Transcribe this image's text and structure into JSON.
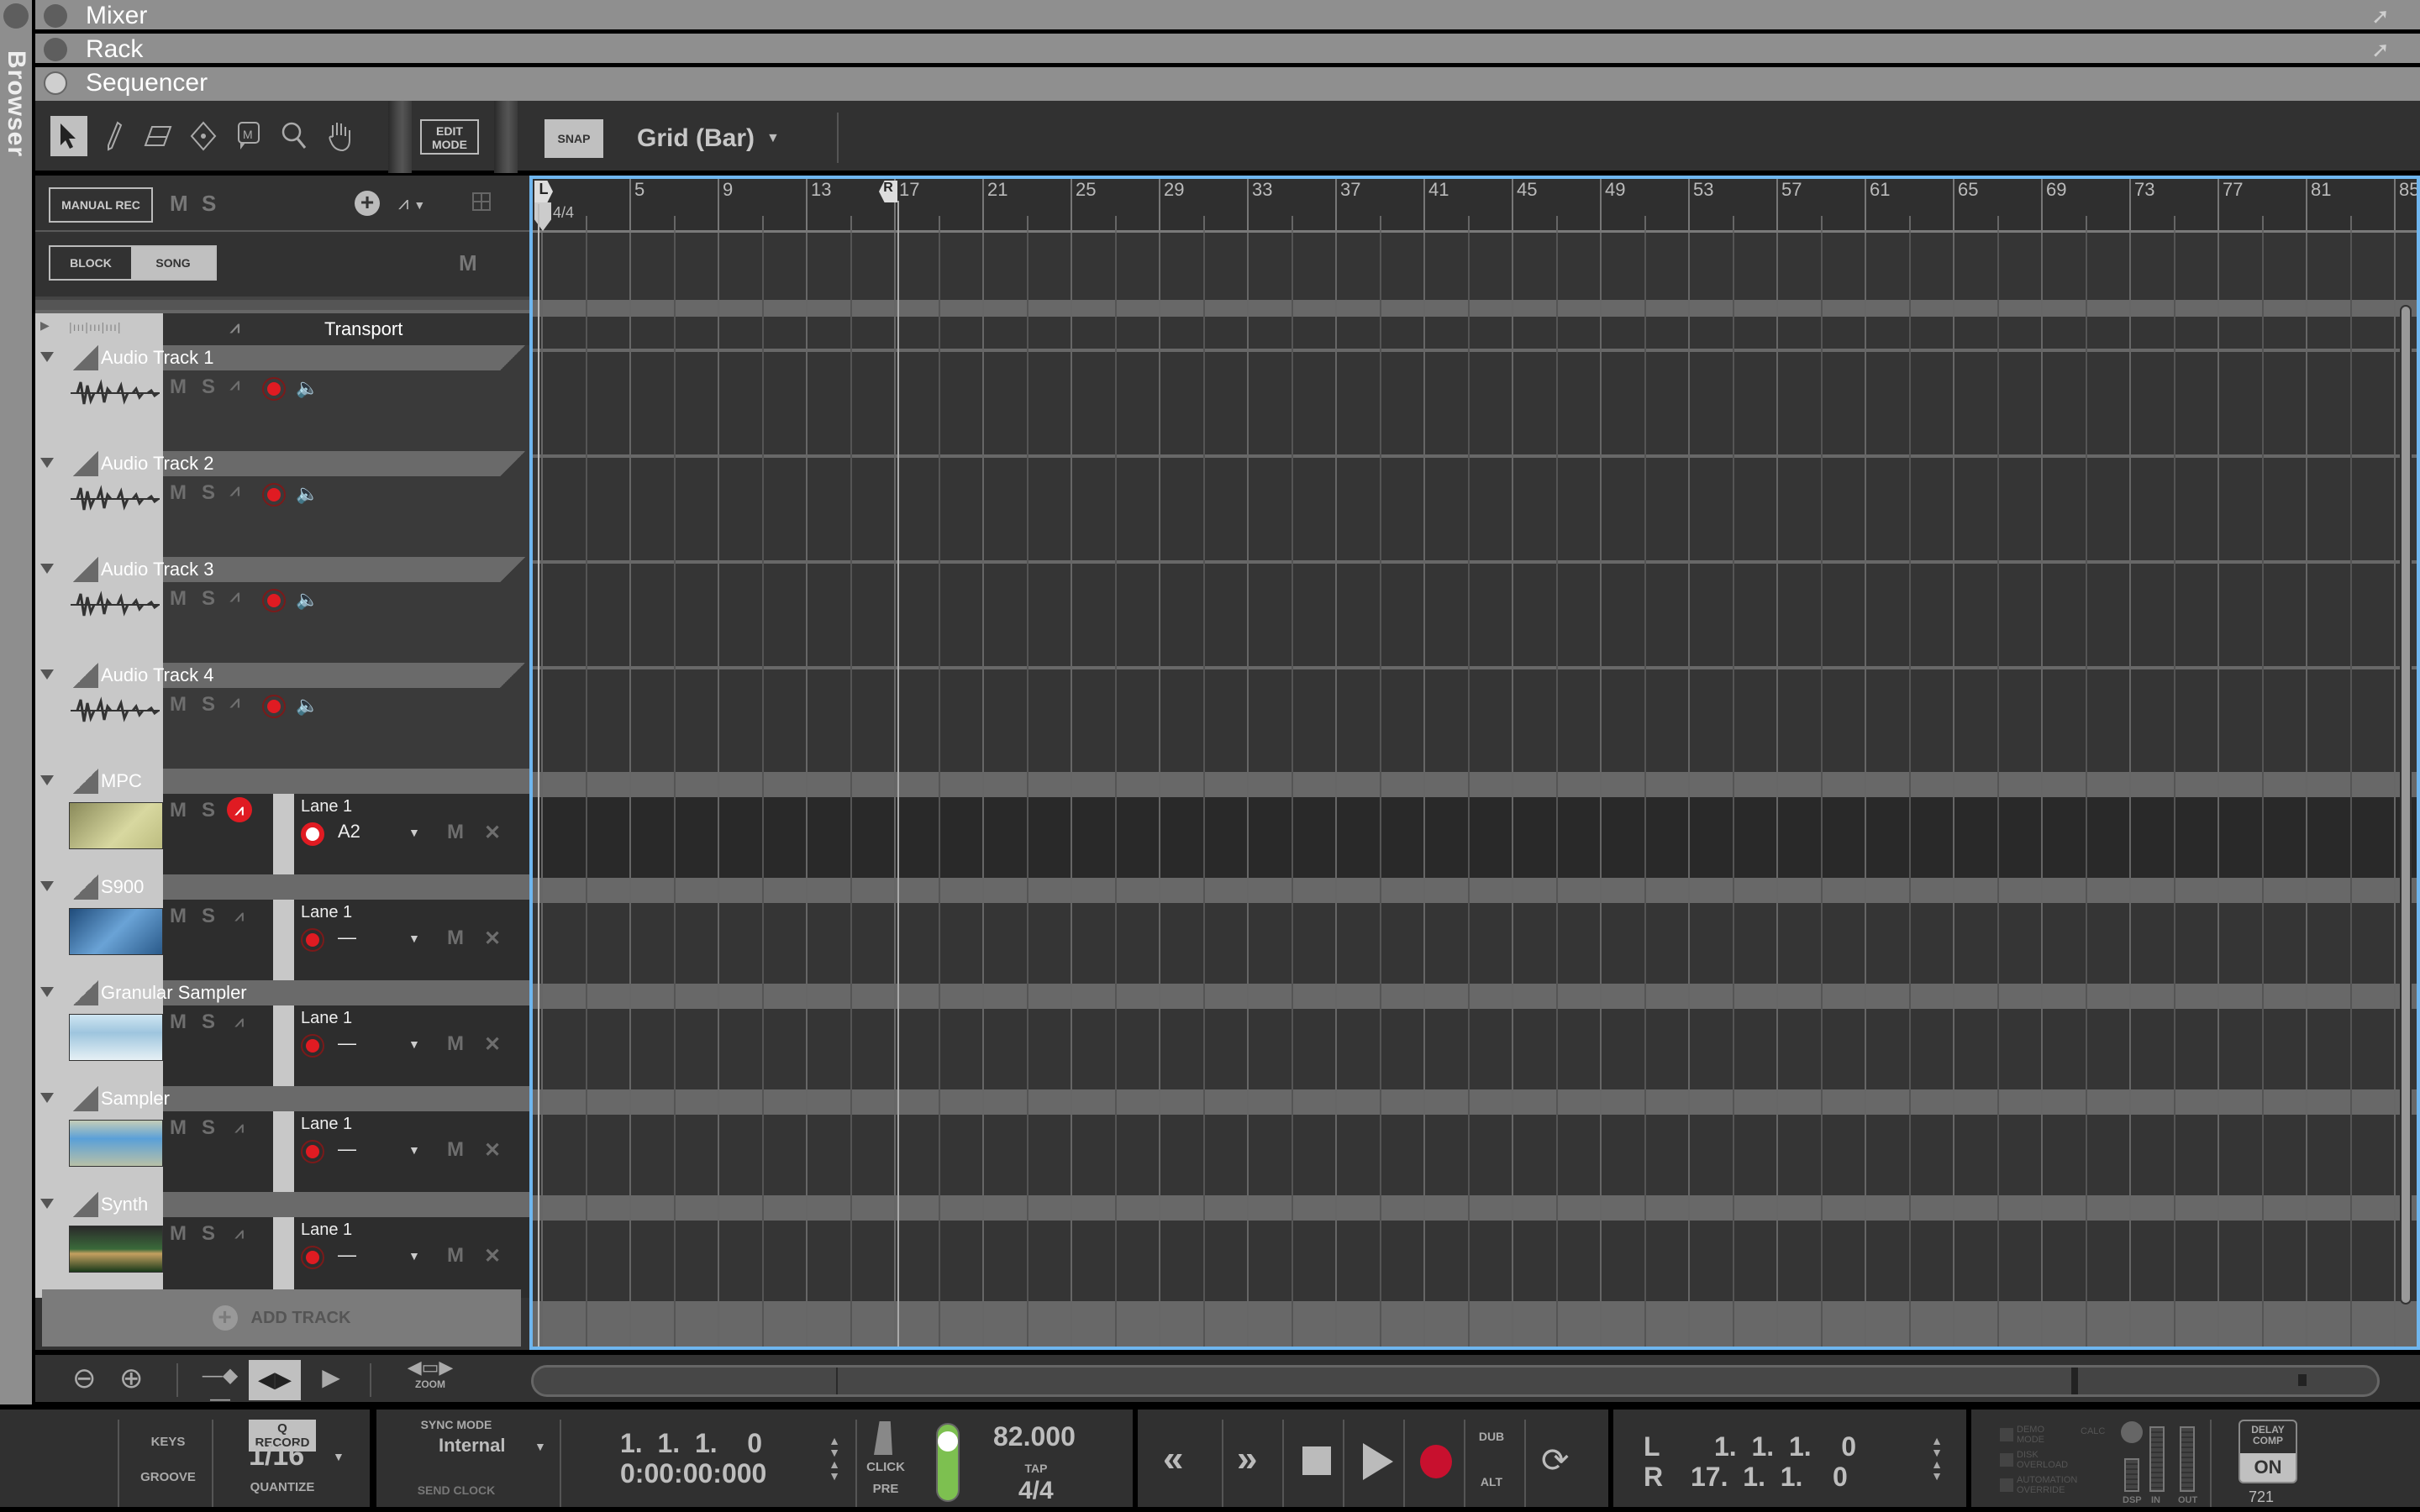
{
  "browser": {
    "label": "Browser"
  },
  "panels": [
    {
      "label": "Mixer",
      "active": false
    },
    {
      "label": "Rack",
      "active": false
    },
    {
      "label": "Sequencer",
      "active": true
    }
  ],
  "toolbar": {
    "tools": [
      "select-tool",
      "pencil-tool",
      "eraser-tool",
      "razor-tool",
      "mute-tool",
      "magnify-tool",
      "hand-tool"
    ],
    "edit_mode_label": "EDIT MODE",
    "snap_label": "SNAP",
    "grid_value": "Grid (Bar)"
  },
  "header": {
    "manual_rec_label": "MANUAL REC",
    "mute_label": "M",
    "solo_label": "S",
    "block_label": "BLOCK",
    "song_label": "SONG",
    "song_active": true,
    "master_mute_label": "M",
    "transport_track_label": "Transport"
  },
  "ruler": {
    "bars": [
      "5",
      "9",
      "13",
      "17",
      "21",
      "25",
      "29",
      "33",
      "37",
      "41",
      "45",
      "49",
      "53",
      "57",
      "61",
      "65",
      "69",
      "73",
      "77",
      "81",
      "85"
    ],
    "left_locator": "L",
    "right_locator": "R",
    "signature": "4/4",
    "left_locator_bar": 1,
    "right_locator_bar": 17,
    "song_position_bar": 1
  },
  "tracks": [
    {
      "name": "Audio Track 1",
      "type": "audio",
      "mute": "M",
      "solo": "S",
      "record_armed": false
    },
    {
      "name": "Audio Track 2",
      "type": "audio",
      "mute": "M",
      "solo": "S",
      "record_armed": false
    },
    {
      "name": "Audio Track 3",
      "type": "audio",
      "mute": "M",
      "solo": "S",
      "record_armed": false
    },
    {
      "name": "Audio Track 4",
      "type": "audio",
      "mute": "M",
      "solo": "S",
      "record_armed": false
    },
    {
      "name": "MPC",
      "type": "instrument",
      "mute": "M",
      "solo": "S",
      "selected": true,
      "lane": {
        "label": "Lane 1",
        "value": "A2",
        "record_active": true,
        "mute": "M"
      }
    },
    {
      "name": "S900",
      "type": "instrument",
      "mute": "M",
      "solo": "S",
      "lane": {
        "label": "Lane 1",
        "value": "—",
        "record_active": false,
        "mute": "M"
      }
    },
    {
      "name": "Granular Sampler",
      "type": "instrument",
      "mute": "M",
      "solo": "S",
      "lane": {
        "label": "Lane 1",
        "value": "—",
        "record_active": false,
        "mute": "M"
      }
    },
    {
      "name": "Sampler",
      "type": "instrument",
      "mute": "M",
      "solo": "S",
      "lane": {
        "label": "Lane 1",
        "value": "—",
        "record_active": false,
        "mute": "M"
      }
    },
    {
      "name": "Synth",
      "type": "instrument",
      "mute": "M",
      "solo": "S",
      "lane": {
        "label": "Lane 1",
        "value": "—",
        "record_active": false,
        "mute": "M"
      }
    }
  ],
  "add_track_label": "ADD TRACK",
  "zoombar": {
    "zoom_label": "ZOOM"
  },
  "transport": {
    "keys_label": "KEYS",
    "groove_label": "GROOVE",
    "q_record_label": "Q RECORD",
    "quantize_value": "1/16",
    "quantize_label": "QUANTIZE",
    "sync_mode_label": "SYNC MODE",
    "sync_mode_value": "Internal",
    "send_clock_label": "SEND CLOCK",
    "position_bars": "1.  1.  1.    0",
    "position_time": "0:00:00:000",
    "click_label": "CLICK",
    "pre_label": "PRE",
    "click_level": 0.8,
    "tempo": "82.000",
    "tap_label": "TAP",
    "signature": "4/4",
    "dub_label": "DUB",
    "alt_label": "ALT",
    "loop_left_label": "L",
    "loop_left_value": "1.  1.  1.    0",
    "loop_right_label": "R",
    "loop_right_value": "17.  1.  1.    0",
    "demo_mode_label": "DEMO MODE",
    "disk_overload_label": "DISK OVERLOAD",
    "automation_override_label": "AUTOMATION OVERRIDE",
    "calc_label": "CALC",
    "dsp_label": "DSP",
    "in_label": "IN",
    "out_label": "OUT",
    "delay_comp_label": "DELAY COMP",
    "delay_comp_state": "ON",
    "delay_comp_value": "721"
  },
  "colors": {
    "accent_blue": "#6fb6ef",
    "record_red": "#e01b22",
    "transport_record": "#c8102e",
    "click_green": "#7dc050"
  }
}
